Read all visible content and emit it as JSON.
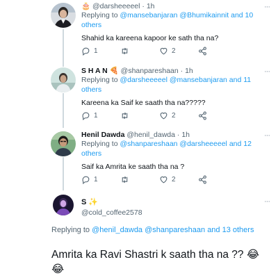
{
  "tweets": [
    {
      "emoji": "🎂",
      "username": "",
      "handle": "@darsheeeeel",
      "time": "1h",
      "replying_prefix": "Replying to",
      "replying_links": "@mansebanjaran @Bhumikainnit",
      "replying_suffix": "and 10 others",
      "text": "Shahid ka kareena kapoor ke sath tha na?",
      "replies": "1",
      "retweets": "",
      "likes": "2"
    },
    {
      "username": "S H A N",
      "emoji": "🍕",
      "handle": "@shanpareshaan",
      "time": "1h",
      "replying_prefix": "Replying to",
      "replying_links": "@darsheeeeel @mansebanjaran",
      "replying_suffix": "and 11 others",
      "text": "Kareena ka Saif ke saath tha na?????",
      "replies": "1",
      "retweets": "",
      "likes": "2"
    },
    {
      "username": "Henil Dawda",
      "handle": "@henil_dawda",
      "time": "1h",
      "replying_prefix": "Replying to",
      "replying_links": "@shanpareshaan @darsheeeeel",
      "replying_suffix": "and 12 others",
      "text": "Saif ka Amrita ke saath tha na ?",
      "replies": "1",
      "retweets": "",
      "likes": "2"
    }
  ],
  "main": {
    "username": "S",
    "emoji": "✨",
    "handle": "@cold_coffee2578",
    "replying_prefix": "Replying to",
    "replying_links": "@henil_dawda @shanpareshaan",
    "replying_suffix": "and 13 others",
    "text": "Amrita ka Ravi Shastri k saath tha na ?? 😂😂"
  },
  "sep": "·",
  "more": "···",
  "icons": [
    "reply-icon",
    "retweet-icon",
    "like-icon",
    "share-icon"
  ],
  "colors": {
    "link": "#1d9bf0",
    "muted": "#536471",
    "text": "#0f1419"
  }
}
